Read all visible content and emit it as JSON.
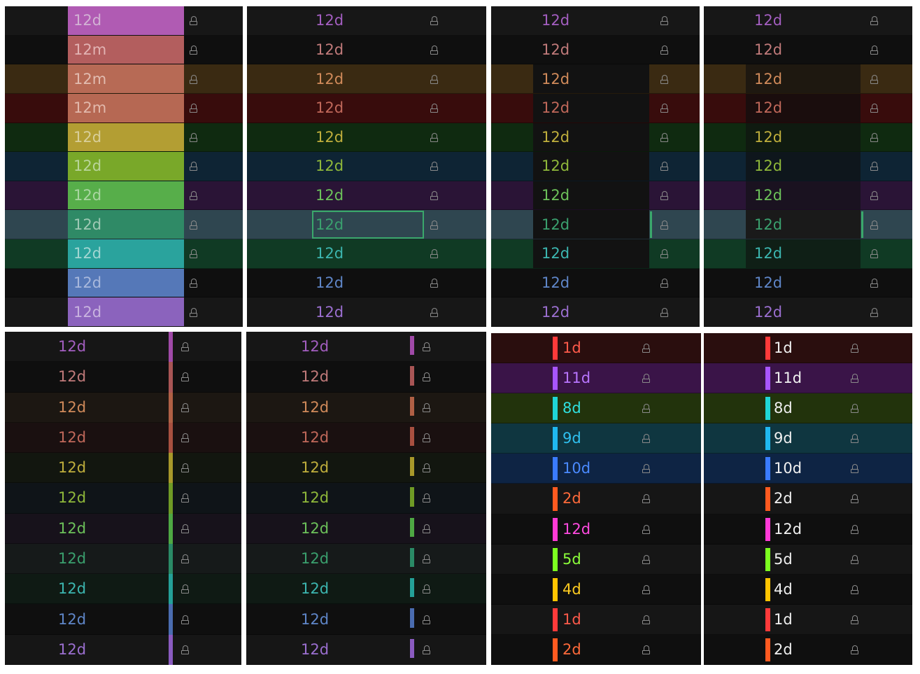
{
  "panels": [
    {
      "id": "p1",
      "variant": "full-fill",
      "labels": [
        "12d",
        "12m",
        "12m",
        "12m",
        "12d",
        "12d",
        "12d",
        "12d",
        "12d",
        "12d",
        "12d"
      ],
      "row_bg": [
        "#171717",
        "#0f0f0f",
        "#3a2a12",
        "#380c0c",
        "#0f2a10",
        "#0e2434",
        "#2a1436",
        "#2f4650",
        "#103a24",
        "#0f0f0f",
        "#171717"
      ],
      "fill": [
        "#b05bb3",
        "#b35e5e",
        "#b76a55",
        "#b66853",
        "#b39e33",
        "#79a829",
        "#57ae4a",
        "#2f8a66",
        "#2aa39d",
        "#5578b8",
        "#8b63bd"
      ],
      "text_color": [
        "#d2b2d4",
        "#e2b3b3",
        "#e2bcb0",
        "#e2b9ac",
        "#d9cf9a",
        "#b9d59a",
        "#aad6a2",
        "#9fc9b5",
        "#a2d6d2",
        "#a8b8dc",
        "#c8b3df"
      ]
    },
    {
      "id": "p2",
      "variant": "row-colored",
      "labels": [
        "12d",
        "12d",
        "12d",
        "12d",
        "12d",
        "12d",
        "12d",
        "12d",
        "12d",
        "12d",
        "12d"
      ],
      "row_bg": [
        "#171717",
        "#0f0f0f",
        "#3a2a12",
        "#380c0c",
        "#0f2a10",
        "#0e2434",
        "#2a1436",
        "#2f4650",
        "#103a24",
        "#0f0f0f",
        "#171717"
      ],
      "text_color": [
        "#a35ec0",
        "#c07a7a",
        "#d08a5a",
        "#c0685a",
        "#bfae3c",
        "#8fb83a",
        "#6cc15a",
        "#3aa06e",
        "#3cb6b0",
        "#5f86c8",
        "#9b6fd0"
      ],
      "selected_row": 7
    },
    {
      "id": "p3",
      "variant": "row-colored-dark-mid",
      "labels": [
        "12d",
        "12d",
        "12d",
        "12d",
        "12d",
        "12d",
        "12d",
        "12d",
        "12d",
        "12d",
        "12d"
      ],
      "row_bg": [
        "#171717",
        "#0f0f0f",
        "#3a2a12",
        "#380c0c",
        "#0f2a10",
        "#0e2434",
        "#2a1436",
        "#2f4650",
        "#103a24",
        "#0f0f0f",
        "#171717"
      ],
      "text_color": [
        "#a35ec0",
        "#c07a7a",
        "#d08a5a",
        "#c0685a",
        "#bfae3c",
        "#8fb83a",
        "#6cc15a",
        "#3aa06e",
        "#3cb6b0",
        "#5f86c8",
        "#9b6fd0"
      ],
      "selected_row": 7
    },
    {
      "id": "p4",
      "variant": "row-colored-tinted-mid",
      "labels": [
        "12d",
        "12d",
        "12d",
        "12d",
        "12d",
        "12d",
        "12d",
        "12d",
        "12d",
        "12d",
        "12d"
      ],
      "row_bg": [
        "#171717",
        "#0f0f0f",
        "#3a2a12",
        "#380c0c",
        "#0f2a10",
        "#0e2434",
        "#2a1436",
        "#2f4650",
        "#103a24",
        "#0f0f0f",
        "#171717"
      ],
      "mid_bg": [
        "#171717",
        "#0f0f0f",
        "#1e1810",
        "#1a0d0d",
        "#0f1a10",
        "#0e161c",
        "#1a1220",
        "#1a1a1a",
        "#0f1f16",
        "#0f0f0f",
        "#171717"
      ],
      "text_color": [
        "#a35ec0",
        "#c07a7a",
        "#d08a5a",
        "#c0685a",
        "#bfae3c",
        "#8fb83a",
        "#6cc15a",
        "#3aa06e",
        "#3cb6b0",
        "#5f86c8",
        "#9b6fd0"
      ],
      "selected_row": 7
    },
    {
      "id": "p5",
      "variant": "right-stripe",
      "labels": [
        "12d",
        "12d",
        "12d",
        "12d",
        "12d",
        "12d",
        "12d",
        "12d",
        "12d",
        "12d",
        "12d"
      ],
      "row_bg": [
        "#161616",
        "#0f0f0f",
        "#1c1712",
        "#1a1010",
        "#12160f",
        "#0f1418",
        "#17121b",
        "#161a1a",
        "#0f1a14",
        "#0f0f0f",
        "#161616"
      ],
      "stripe": [
        "#a04aa8",
        "#a85555",
        "#b06045",
        "#a85040",
        "#a8982a",
        "#6f9a25",
        "#4ea843",
        "#2a8a66",
        "#24a098",
        "#4a6cb0",
        "#8a5bc0"
      ],
      "text_color": [
        "#a35ec0",
        "#c07a7a",
        "#d08a5a",
        "#c0685a",
        "#bfae3c",
        "#8fb83a",
        "#6cc15a",
        "#3aa06e",
        "#3cb6b0",
        "#5f86c8",
        "#9b6fd0"
      ]
    },
    {
      "id": "p6",
      "variant": "short-stripe",
      "labels": [
        "12d",
        "12d",
        "12d",
        "12d",
        "12d",
        "12d",
        "12d",
        "12d",
        "12d",
        "12d",
        "12d"
      ],
      "row_bg": [
        "#161616",
        "#0f0f0f",
        "#1c1712",
        "#1a1010",
        "#12160f",
        "#0f1418",
        "#17121b",
        "#161a1a",
        "#0f1a14",
        "#0f0f0f",
        "#161616"
      ],
      "stripe": [
        "#a04aa8",
        "#a85555",
        "#b06045",
        "#a85040",
        "#a8982a",
        "#6f9a25",
        "#4ea843",
        "#2a8a66",
        "#24a098",
        "#4a6cb0",
        "#8a5bc0"
      ],
      "text_color": [
        "#a35ec0",
        "#c07a7a",
        "#d08a5a",
        "#c0685a",
        "#bfae3c",
        "#8fb83a",
        "#6cc15a",
        "#3aa06e",
        "#3cb6b0",
        "#5f86c8",
        "#9b6fd0"
      ]
    },
    {
      "id": "p7",
      "variant": "vivid-tag",
      "labels": [
        "1d",
        "11d",
        "8d",
        "9d",
        "10d",
        "2d",
        "12d",
        "5d",
        "4d",
        "1d",
        "2d"
      ],
      "row_bg": [
        "#2a0e0e",
        "#3a1448",
        "#22330c",
        "#0f3640",
        "#0e2444",
        "#161616",
        "#0f0f0f",
        "#161616",
        "#0f0f0f",
        "#161616",
        "#0f0f0f"
      ],
      "stripe": [
        "#ff3a3a",
        "#a855ff",
        "#1fd6d6",
        "#1fb8f0",
        "#3a7bff",
        "#ff5a20",
        "#ff3ad6",
        "#7cff20",
        "#ffc400",
        "#ff3a3a",
        "#ff5a20"
      ],
      "text_color": [
        "#ff5a4a",
        "#b875ff",
        "#2fe0e0",
        "#2fc0f0",
        "#4a8aff",
        "#ff6a3a",
        "#ff4ae0",
        "#8cff3a",
        "#ffcc20",
        "#ff5a4a",
        "#ff6a3a"
      ]
    },
    {
      "id": "p8",
      "variant": "vivid-tag-white",
      "labels": [
        "1d",
        "11d",
        "8d",
        "9d",
        "10d",
        "2d",
        "12d",
        "5d",
        "4d",
        "1d",
        "2d"
      ],
      "row_bg": [
        "#2a0e0e",
        "#3a1448",
        "#22330c",
        "#0f3640",
        "#0e2444",
        "#161616",
        "#0f0f0f",
        "#161616",
        "#0f0f0f",
        "#161616",
        "#0f0f0f"
      ],
      "stripe": [
        "#ff3a3a",
        "#a855ff",
        "#1fd6d6",
        "#1fb8f0",
        "#3a7bff",
        "#ff5a20",
        "#ff3ad6",
        "#7cff20",
        "#ffc400",
        "#ff3a3a",
        "#ff5a20"
      ],
      "text_color": [
        "#f0f0f0",
        "#f0f0f0",
        "#f0f0f0",
        "#f0f0f0",
        "#f0f0f0",
        "#f0f0f0",
        "#f0f0f0",
        "#f0f0f0",
        "#f0f0f0",
        "#f0f0f0",
        "#f0f0f0"
      ]
    }
  ],
  "colors": {
    "lock": "#8a8a8a",
    "selection": "#3aa86b",
    "page_bg": "#ffffff"
  },
  "icon": "lock-icon"
}
